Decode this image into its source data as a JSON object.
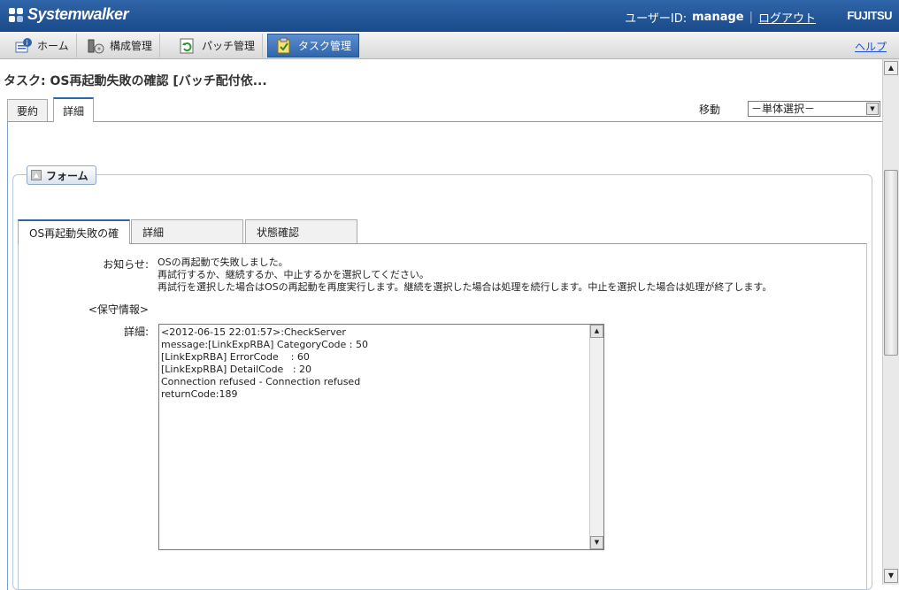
{
  "topbar": {
    "app_name": "Systemwalker",
    "user_label": "ユーザーID:",
    "user_name": "manage",
    "logout": "ログアウト",
    "brand": "FUJITSU"
  },
  "menu": {
    "items": [
      {
        "label": "ホーム",
        "icon": "home-icon"
      },
      {
        "label": "構成管理",
        "icon": "config-icon"
      },
      {
        "label": "パッチ管理",
        "icon": "patch-icon"
      },
      {
        "label": "タスク管理",
        "icon": "task-icon"
      }
    ],
    "active": "タスク管理",
    "help": "ヘルプ"
  },
  "page": {
    "title": "タスク: OS再起動失敗の確認 [バッチ配付依...",
    "tabs": [
      "要約",
      "詳細"
    ],
    "active_tab": "詳細",
    "move_label": "移動",
    "move_select": "－単体選択－"
  },
  "form": {
    "button": "フォーム",
    "tabs": [
      "OS再起動失敗の確",
      "詳細",
      "状態確認"
    ],
    "active_tab": "OS再起動失敗の確",
    "notice_label": "お知らせ:",
    "notice_lines": [
      "OSの再起動で失敗しました。",
      "再試行するか、継続するか、中止するかを選択してください。",
      "再試行を選択した場合はOSの再起動を再度実行します。継続を選択した場合は処理を続行します。中止を選択した場合は処理が終了します。"
    ],
    "maintenance_label": "<保守情報>",
    "detail_label": "詳細:",
    "detail_text": "<2012-06-15 22:01:57>:CheckServer\nmessage:[LinkExpRBA] CategoryCode : 50\n[LinkExpRBA] ErrorCode    : 60\n[LinkExpRBA] DetailCode   : 20\nConnection refused - Connection refused\nreturnCode:189"
  }
}
